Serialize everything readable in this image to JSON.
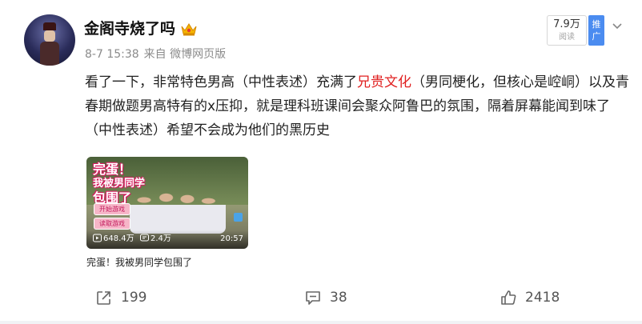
{
  "post": {
    "username": "金阁寺烧了吗",
    "crown_icon": "crown-icon",
    "time": "8-7 15:38",
    "source": "来自 微博网页版",
    "views": "7.9万",
    "views_label": "阅读",
    "promo_label": "推广",
    "text_before": "看了一下，非常特色男高（中性表述）充满了",
    "text_highlight": "兄贵文化",
    "text_after": "（男同梗化，但核心是崆峒）以及青春期做题男高特有的x压抑，就是理科班课间会聚众阿鲁巴的氛围，隔着屏幕能闻到味了（中性表述）希望不会成为他们的黑历史",
    "highlight_color": "#e02020"
  },
  "video": {
    "overlay_line1": "完蛋！",
    "overlay_line2": "我被男同学",
    "overlay_line3": "包围了",
    "btn_start": "开始游戏",
    "btn_load": "读取游戏",
    "plays": "648.4万",
    "danmu": "2.4万",
    "duration": "20:57",
    "caption": "完蛋！我被男同学包围了"
  },
  "actions": {
    "share_count": "199",
    "comment_count": "38",
    "like_count": "2418"
  }
}
